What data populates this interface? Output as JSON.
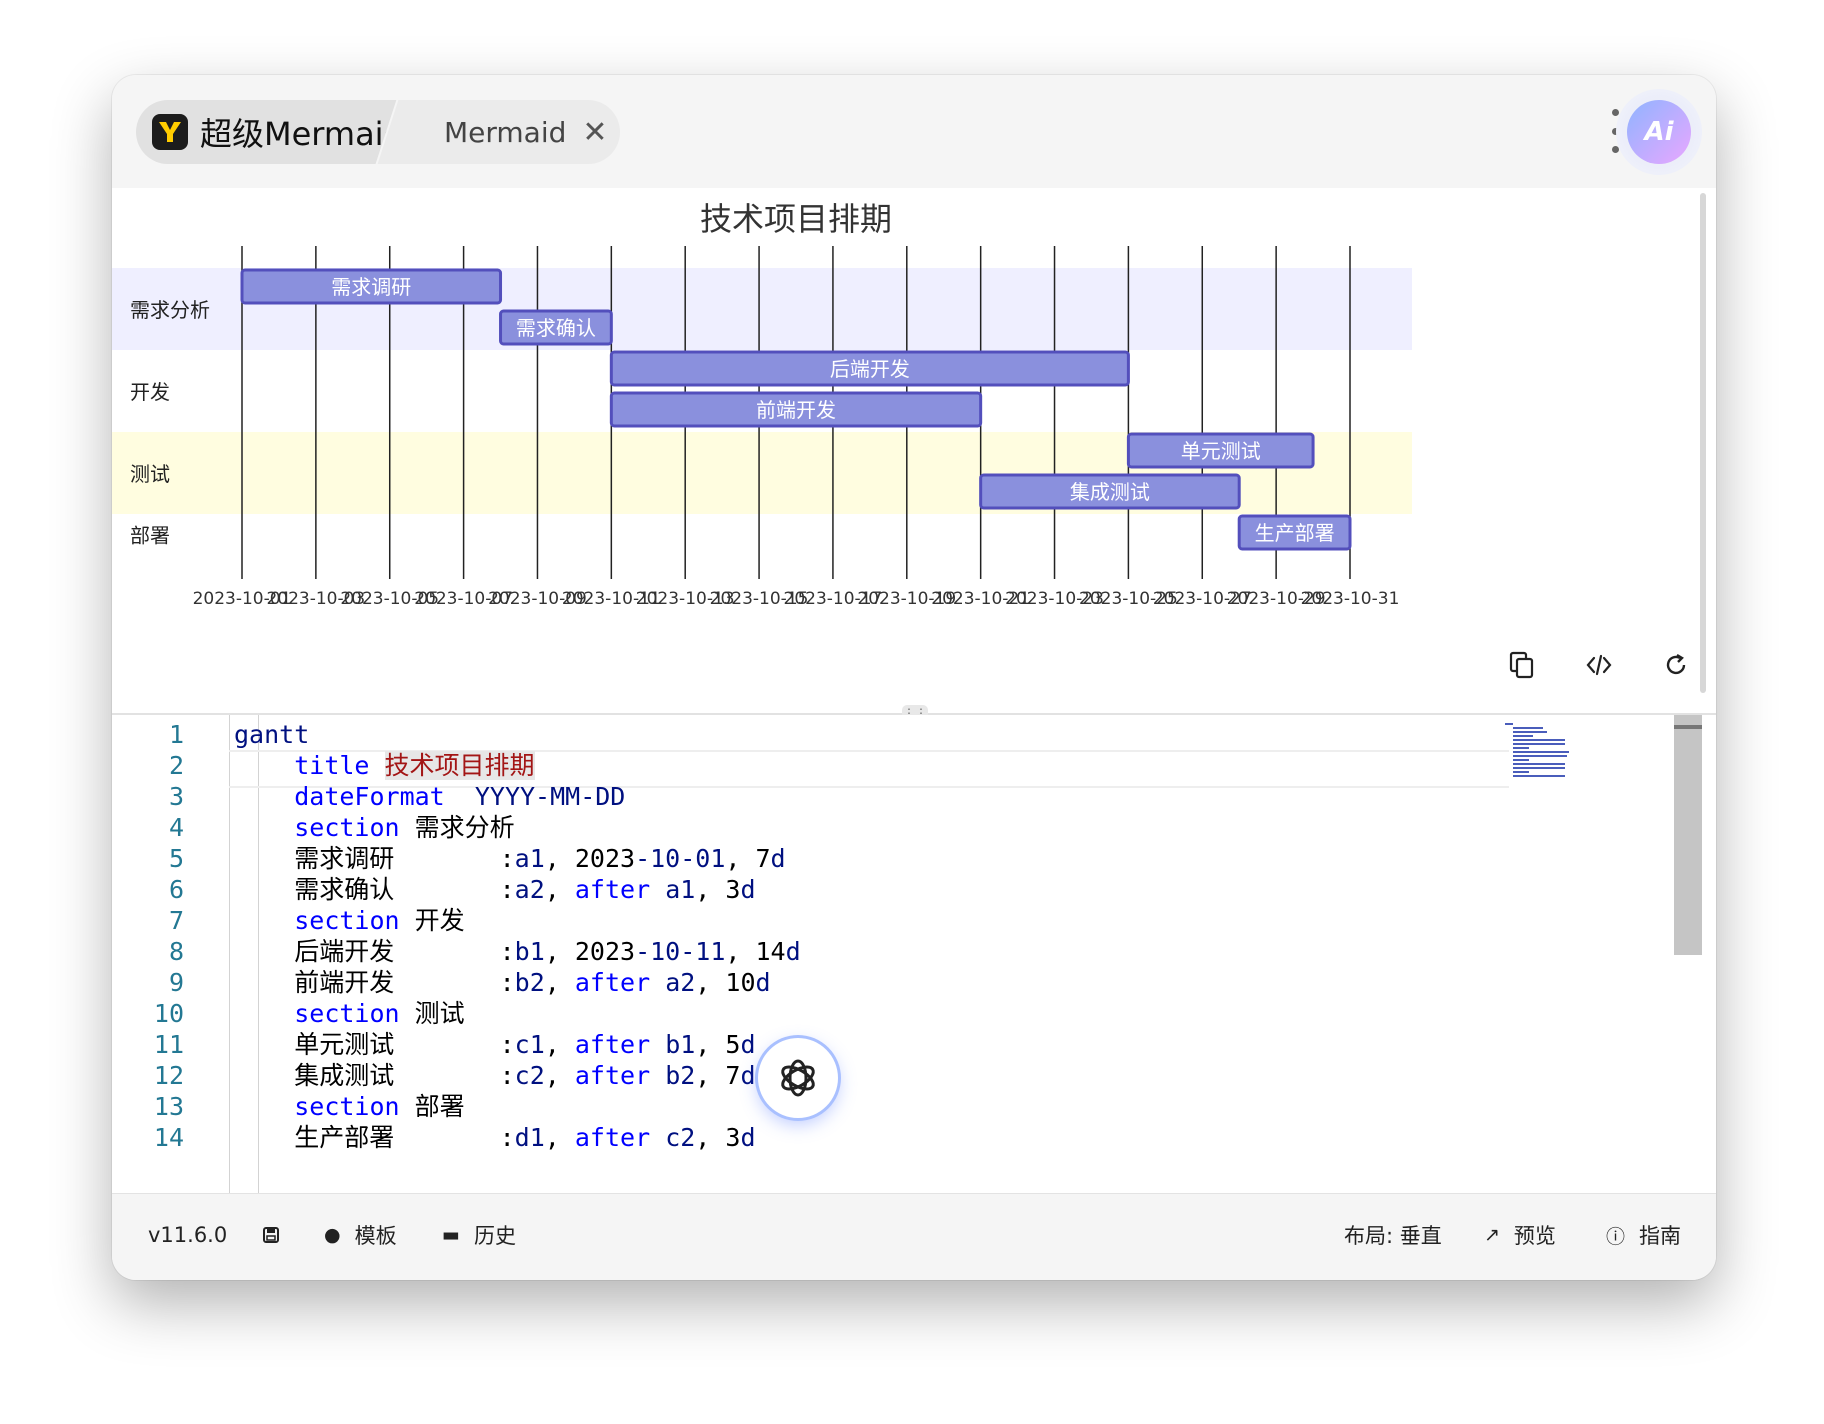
{
  "tabs": {
    "main_label": "超级Mermaid",
    "sub_label": "Mermaid"
  },
  "ai_button": {
    "label": "Ai",
    "icon": "ai-orb-icon"
  },
  "chart_data": {
    "type": "gantt",
    "title": "技术项目排期",
    "date_format": "YYYY-MM-DD",
    "x_ticks": [
      "2023-10-01",
      "2023-10-03",
      "2023-10-05",
      "2023-10-07",
      "2023-10-09",
      "2023-10-11",
      "2023-10-13",
      "2023-10-15",
      "2023-10-17",
      "2023-10-19",
      "2023-10-21",
      "2023-10-23",
      "2023-10-25",
      "2023-10-27",
      "2023-10-29",
      "2023-10-31"
    ],
    "x_range": [
      "2023-10-01",
      "2023-10-31"
    ],
    "sections": [
      {
        "name": "需求分析",
        "color": "#efefff",
        "tasks": [
          {
            "name": "需求调研",
            "id": "a1",
            "start": "2023-10-01",
            "end": "2023-10-08",
            "duration_days": 7
          },
          {
            "name": "需求确认",
            "id": "a2",
            "start": "2023-10-08",
            "end": "2023-10-11",
            "duration_days": 3
          }
        ]
      },
      {
        "name": "开发",
        "color": "#ffffff",
        "tasks": [
          {
            "name": "后端开发",
            "id": "b1",
            "start": "2023-10-11",
            "end": "2023-10-25",
            "duration_days": 14
          },
          {
            "name": "前端开发",
            "id": "b2",
            "start": "2023-10-11",
            "end": "2023-10-21",
            "duration_days": 10
          }
        ]
      },
      {
        "name": "测试",
        "color": "#fffde0",
        "tasks": [
          {
            "name": "单元测试",
            "id": "c1",
            "start": "2023-10-25",
            "end": "2023-10-30",
            "duration_days": 5
          },
          {
            "name": "集成测试",
            "id": "c2",
            "start": "2023-10-21",
            "end": "2023-10-28",
            "duration_days": 7
          }
        ]
      },
      {
        "name": "部署",
        "color": "#ffffff",
        "tasks": [
          {
            "name": "生产部署",
            "id": "d1",
            "start": "2023-10-28",
            "end": "2023-10-31",
            "duration_days": 3
          }
        ]
      }
    ],
    "bar_color": "#8a90dd",
    "bar_stroke": "#534fbc"
  },
  "preview_tools": {
    "copy_icon": "copy-icon",
    "code_icon": "code-icon",
    "refresh_icon": "refresh-icon"
  },
  "editor": {
    "lines": [
      {
        "n": "1",
        "parts": [
          [
            "kw2",
            "gantt"
          ]
        ]
      },
      {
        "n": "2",
        "parts": [
          [
            "pad",
            "    "
          ],
          [
            "kw",
            "title"
          ],
          [
            "plain",
            " "
          ],
          [
            "str",
            "技术项目排期"
          ]
        ]
      },
      {
        "n": "3",
        "parts": [
          [
            "pad",
            "    "
          ],
          [
            "kw",
            "dateFormat"
          ],
          [
            "plain",
            "  "
          ],
          [
            "kw2",
            "YYYY-MM-DD"
          ]
        ]
      },
      {
        "n": "4",
        "parts": [
          [
            "pad",
            "    "
          ],
          [
            "kw",
            "section"
          ],
          [
            "plain",
            " 需求分析"
          ]
        ]
      },
      {
        "n": "5",
        "parts": [
          [
            "pad",
            "    "
          ],
          [
            "plain",
            "需求调研       :"
          ],
          [
            "kw2",
            "a1"
          ],
          [
            "plain",
            ", 2023"
          ],
          [
            "kw2",
            "-10-01"
          ],
          [
            "plain",
            ", 7"
          ],
          [
            "kw2",
            "d"
          ]
        ]
      },
      {
        "n": "6",
        "parts": [
          [
            "pad",
            "    "
          ],
          [
            "plain",
            "需求确认       :"
          ],
          [
            "kw2",
            "a2"
          ],
          [
            "plain",
            ", "
          ],
          [
            "kw",
            "after"
          ],
          [
            "plain",
            " "
          ],
          [
            "kw2",
            "a1"
          ],
          [
            "plain",
            ", 3"
          ],
          [
            "kw2",
            "d"
          ]
        ]
      },
      {
        "n": "7",
        "parts": [
          [
            "pad",
            "    "
          ],
          [
            "kw",
            "section"
          ],
          [
            "plain",
            " 开发"
          ]
        ]
      },
      {
        "n": "8",
        "parts": [
          [
            "pad",
            "    "
          ],
          [
            "plain",
            "后端开发       :"
          ],
          [
            "kw2",
            "b1"
          ],
          [
            "plain",
            ", 2023"
          ],
          [
            "kw2",
            "-10-11"
          ],
          [
            "plain",
            ", 14"
          ],
          [
            "kw2",
            "d"
          ]
        ]
      },
      {
        "n": "9",
        "parts": [
          [
            "pad",
            "    "
          ],
          [
            "plain",
            "前端开发       :"
          ],
          [
            "kw2",
            "b2"
          ],
          [
            "plain",
            ", "
          ],
          [
            "kw",
            "after"
          ],
          [
            "plain",
            " "
          ],
          [
            "kw2",
            "a2"
          ],
          [
            "plain",
            ", 10"
          ],
          [
            "kw2",
            "d"
          ]
        ]
      },
      {
        "n": "10",
        "parts": [
          [
            "pad",
            "    "
          ],
          [
            "kw",
            "section"
          ],
          [
            "plain",
            " 测试"
          ]
        ]
      },
      {
        "n": "11",
        "parts": [
          [
            "pad",
            "    "
          ],
          [
            "plain",
            "单元测试       :"
          ],
          [
            "kw2",
            "c1"
          ],
          [
            "plain",
            ", "
          ],
          [
            "kw",
            "after"
          ],
          [
            "plain",
            " "
          ],
          [
            "kw2",
            "b1"
          ],
          [
            "plain",
            ", 5"
          ],
          [
            "kw2",
            "d"
          ]
        ]
      },
      {
        "n": "12",
        "parts": [
          [
            "pad",
            "    "
          ],
          [
            "plain",
            "集成测试       :"
          ],
          [
            "kw2",
            "c2"
          ],
          [
            "plain",
            ", "
          ],
          [
            "kw",
            "after"
          ],
          [
            "plain",
            " "
          ],
          [
            "kw2",
            "b2"
          ],
          [
            "plain",
            ", 7"
          ],
          [
            "kw2",
            "d"
          ]
        ]
      },
      {
        "n": "13",
        "parts": [
          [
            "pad",
            "    "
          ],
          [
            "kw",
            "section"
          ],
          [
            "plain",
            " 部署"
          ]
        ]
      },
      {
        "n": "14",
        "parts": [
          [
            "pad",
            "    "
          ],
          [
            "plain",
            "生产部署       :"
          ],
          [
            "kw2",
            "d1"
          ],
          [
            "plain",
            ", "
          ],
          [
            "kw",
            "after"
          ],
          [
            "plain",
            " "
          ],
          [
            "kw2",
            "c2"
          ],
          [
            "plain",
            ", 3"
          ],
          [
            "kw2",
            "d"
          ]
        ]
      }
    ]
  },
  "statusbar": {
    "version": "v11.6.0",
    "save_icon": "save-icon",
    "template_label": "模板",
    "template_icon": "bulb-icon",
    "history_label": "历史",
    "history_icon": "folder-icon",
    "layout_label": "布局: 垂直",
    "preview_label": "预览",
    "preview_icon": "external-link-icon",
    "guide_label": "指南",
    "guide_icon": "help-icon"
  },
  "gpt_button": {
    "icon": "openai-icon"
  }
}
